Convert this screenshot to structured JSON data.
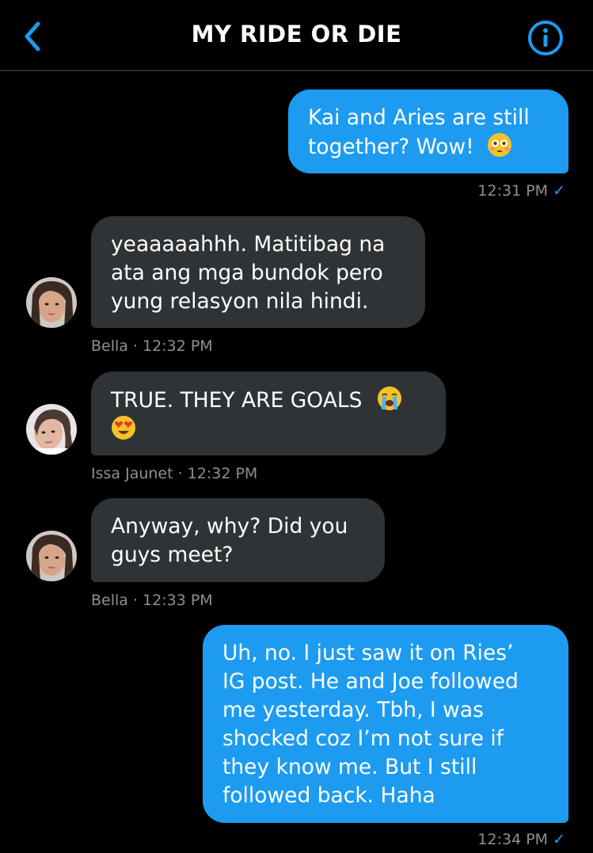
{
  "header": {
    "title": "MY RIDE OR DIE",
    "back_icon": "chevron-left-icon",
    "info_icon": "info-icon",
    "accent": "#1d9bf0"
  },
  "messages": [
    {
      "direction": "outgoing",
      "lines": [
        "Kai and Aries are still",
        "together? Wow!"
      ],
      "emoji": [
        "flushed-face-emoji"
      ],
      "meta": "12:31 PM",
      "read": "✓"
    },
    {
      "direction": "incoming",
      "lines": [
        "yeaaaaahhh. Matitibag na",
        "ata ang mga bundok pero",
        "yung relasyon nila hindi."
      ],
      "meta": "Bella · 12:32 PM",
      "avatar": "avatar-bella"
    },
    {
      "direction": "incoming",
      "lines": [
        "TRUE. THEY ARE GOALS"
      ],
      "emoji": [
        "loudly-crying-face-emoji",
        "heart-eyes-emoji"
      ],
      "meta": "Issa Jaunet · 12:32 PM",
      "avatar": "avatar-issa"
    },
    {
      "direction": "incoming",
      "lines": [
        "Anyway, why? Did you",
        "guys meet?"
      ],
      "meta": "Bella · 12:33 PM",
      "avatar": "avatar-bella"
    },
    {
      "direction": "outgoing",
      "lines": [
        "Uh, no. I just saw it on Ries’",
        "IG post. He and Joe followed",
        "me yesterday. Tbh, I was",
        "shocked coz I’m not sure if",
        "they know me. But I still",
        "followed back. Haha"
      ],
      "meta": "12:34 PM",
      "read": "✓"
    }
  ],
  "colors": {
    "outgoing_bubble": "#1d9bf0",
    "incoming_bubble": "#2f3336",
    "meta_text": "#8b9095",
    "background": "#000000"
  }
}
